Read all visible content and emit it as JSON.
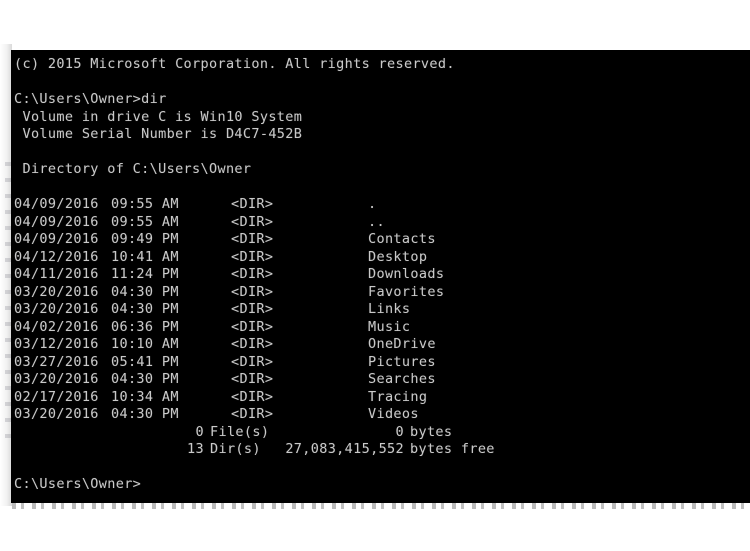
{
  "console": {
    "window_kind": "windows-command-prompt",
    "background_color": "#000000",
    "text_color": "#c9c9c9",
    "header_lines": [
      "(c) 2015 Microsoft Corporation. All rights reserved.",
      "",
      "C:\\Users\\Owner>dir",
      " Volume in drive C is Win10 System",
      " Volume Serial Number is D4C7-452B",
      "",
      " Directory of C:\\Users\\Owner",
      ""
    ],
    "copyright_line": "(c) 2015 Microsoft Corporation. All rights reserved.",
    "command_line": "C:\\Users\\Owner>dir",
    "volume_label_line": " Volume in drive C is Win10 System",
    "volume_serial_line": " Volume Serial Number is D4C7-452B",
    "directory_of_line": " Directory of C:\\Users\\Owner",
    "entries": [
      {
        "date": "04/09/2016",
        "time": "09:55 AM",
        "type": "<DIR>",
        "name": "."
      },
      {
        "date": "04/09/2016",
        "time": "09:55 AM",
        "type": "<DIR>",
        "name": ".."
      },
      {
        "date": "04/09/2016",
        "time": "09:49 PM",
        "type": "<DIR>",
        "name": "Contacts"
      },
      {
        "date": "04/12/2016",
        "time": "10:41 AM",
        "type": "<DIR>",
        "name": "Desktop"
      },
      {
        "date": "04/11/2016",
        "time": "11:24 PM",
        "type": "<DIR>",
        "name": "Downloads"
      },
      {
        "date": "03/20/2016",
        "time": "04:30 PM",
        "type": "<DIR>",
        "name": "Favorites"
      },
      {
        "date": "03/20/2016",
        "time": "04:30 PM",
        "type": "<DIR>",
        "name": "Links"
      },
      {
        "date": "04/02/2016",
        "time": "06:36 PM",
        "type": "<DIR>",
        "name": "Music"
      },
      {
        "date": "03/12/2016",
        "time": "10:10 AM",
        "type": "<DIR>",
        "name": "OneDrive"
      },
      {
        "date": "03/27/2016",
        "time": "05:41 PM",
        "type": "<DIR>",
        "name": "Pictures"
      },
      {
        "date": "03/20/2016",
        "time": "04:30 PM",
        "type": "<DIR>",
        "name": "Searches"
      },
      {
        "date": "02/17/2016",
        "time": "10:34 AM",
        "type": "<DIR>",
        "name": "Tracing"
      },
      {
        "date": "03/20/2016",
        "time": "04:30 PM",
        "type": "<DIR>",
        "name": "Videos"
      }
    ],
    "summary": {
      "file_count": "0",
      "file_label": "File(s)",
      "file_bytes": "0",
      "file_bytes_unit": "bytes",
      "dir_count": "13",
      "dir_label": "Dir(s)",
      "free_bytes": "27,083,415,552",
      "free_bytes_unit": "bytes free"
    },
    "trailing_prompt": "C:\\Users\\Owner>"
  }
}
